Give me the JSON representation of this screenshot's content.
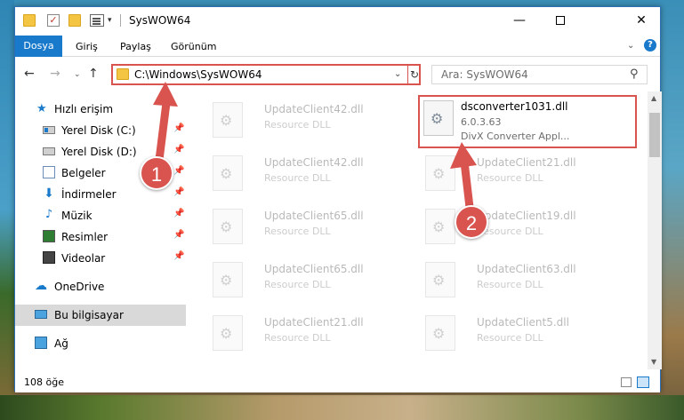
{
  "window": {
    "title": "SysWOW64",
    "minimize": "—",
    "maximize": "",
    "close": "✕"
  },
  "quick_access_toolbar": {
    "dropdown": "▾"
  },
  "ribbon": {
    "tabs": [
      "Dosya",
      "Giriş",
      "Paylaş",
      "Görünüm"
    ],
    "expand": "⌄",
    "help": "?"
  },
  "navigation": {
    "back": "←",
    "forward": "→",
    "history": "⌄",
    "up": "↑",
    "address": "C:\\Windows\\SysWOW64",
    "address_dropdown": "⌄",
    "refresh": "↻",
    "search_placeholder": "Ara: SysWOW64",
    "search_icon": "⚲"
  },
  "sidebar": {
    "items": [
      {
        "label": "Hızlı erişim",
        "icon": "star-icon",
        "pinned": false
      },
      {
        "label": "Yerel Disk (C:)",
        "icon": "drive-icon",
        "pinned": true
      },
      {
        "label": "Yerel Disk (D:)",
        "icon": "drive-icon",
        "pinned": true
      },
      {
        "label": "Belgeler",
        "icon": "documents-icon",
        "pinned": true
      },
      {
        "label": "İndirmeler",
        "icon": "download-icon",
        "pinned": true
      },
      {
        "label": "Müzik",
        "icon": "music-icon",
        "pinned": true
      },
      {
        "label": "Resimler",
        "icon": "pictures-icon",
        "pinned": true
      },
      {
        "label": "Videolar",
        "icon": "videos-icon",
        "pinned": true
      },
      {
        "label": "OneDrive",
        "icon": "cloud-icon",
        "pinned": false
      },
      {
        "label": "Bu bilgisayar",
        "icon": "computer-icon",
        "pinned": false,
        "selected": true
      },
      {
        "label": "Ağ",
        "icon": "network-icon",
        "pinned": false
      }
    ],
    "pin_glyph": "📌"
  },
  "files": {
    "left_column": [
      {
        "name": "UpdateClient42.dll",
        "type": "Resource DLL"
      },
      {
        "name": "UpdateClient42.dll",
        "type": "Resource DLL"
      },
      {
        "name": "UpdateClient65.dll",
        "type": "Resource DLL"
      },
      {
        "name": "UpdateClient65.dll",
        "type": "Resource DLL"
      },
      {
        "name": "UpdateClient21.dll",
        "type": "Resource DLL"
      }
    ],
    "highlighted": {
      "name": "dsconverter1031.dll",
      "version": "6.0.3.63",
      "type": "DivX Converter Appl..."
    },
    "right_column": [
      {
        "name": "UpdateClient21.dll",
        "type": "Resource DLL"
      },
      {
        "name": "UpdateClient19.dll",
        "type": "Resource DLL"
      },
      {
        "name": "UpdateClient63.dll",
        "type": "Resource DLL"
      },
      {
        "name": "UpdateClient5.dll",
        "type": "Resource DLL"
      }
    ]
  },
  "scrollbar": {
    "up": "▲",
    "down": "▼"
  },
  "status": {
    "item_count": "108 öğe"
  },
  "annotations": {
    "step1": "1",
    "step2": "2",
    "color": "#d9534f"
  }
}
